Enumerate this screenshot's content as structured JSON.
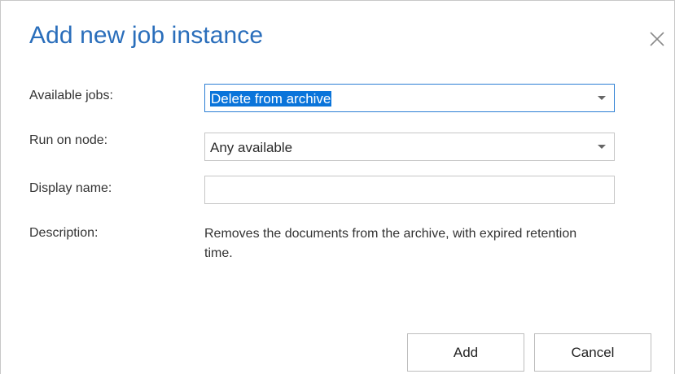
{
  "dialog": {
    "title": "Add new job instance",
    "close_icon": "close-icon"
  },
  "form": {
    "available_jobs": {
      "label": "Available jobs:",
      "value": "Delete from archive"
    },
    "run_on_node": {
      "label": "Run on node:",
      "value": "Any available"
    },
    "display_name": {
      "label": "Display name:",
      "value": ""
    },
    "description": {
      "label": "Description:",
      "value": "Removes the documents from the archive, with expired retention time."
    }
  },
  "buttons": {
    "add_label": "Add",
    "cancel_label": "Cancel"
  },
  "colors": {
    "title": "#2a6ebb",
    "selection": "#0a74da",
    "focus_border": "#2c7fd4"
  }
}
